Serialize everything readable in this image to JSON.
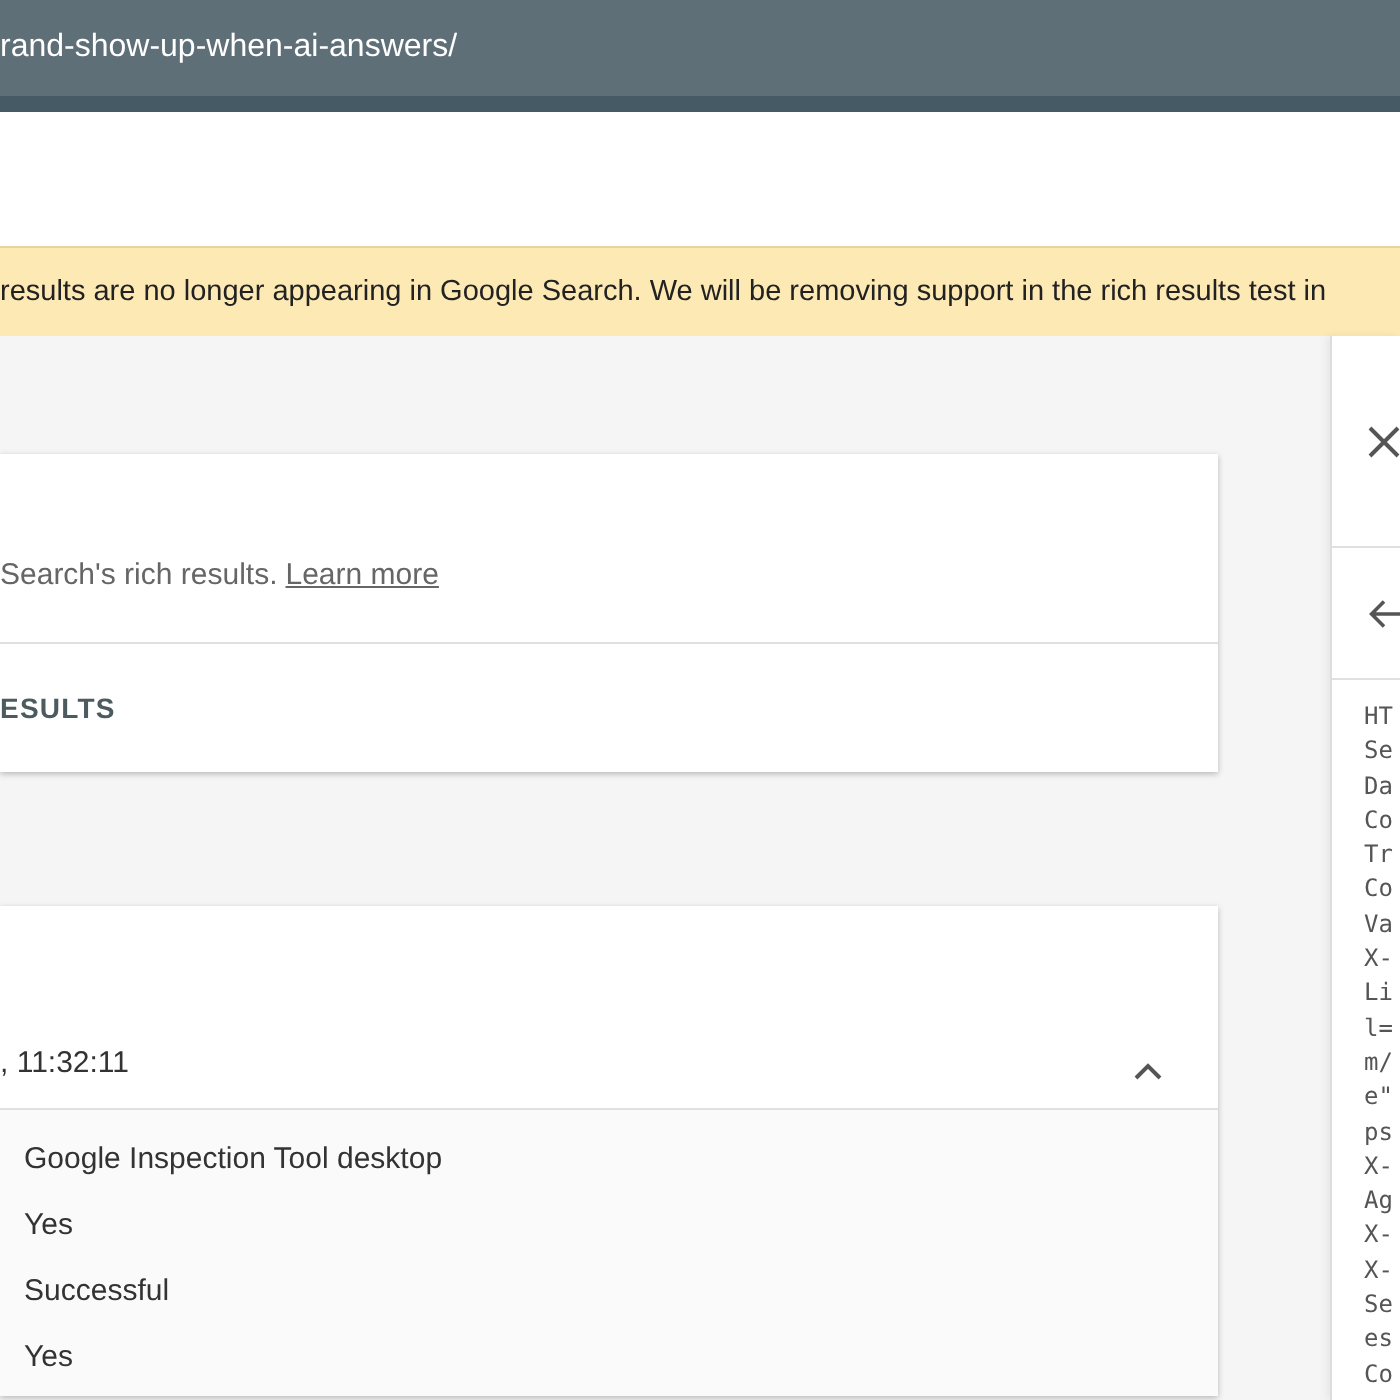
{
  "address_bar": {
    "url": "rand-show-up-when-ai-answers/"
  },
  "banner": {
    "text": "results are no longer appearing in Google Search. We will be removing support in the rich results test in"
  },
  "intro_card": {
    "description": "Search's rich results.",
    "link": "Learn more",
    "action": "ESULTS"
  },
  "inspection_card": {
    "timestamp": ", 11:32:11",
    "expanded": true,
    "details": [
      "Google Inspection Tool desktop",
      "Yes",
      "Successful",
      "Yes"
    ]
  },
  "side_panel": {
    "response_lines": [
      "HT",
      "Se",
      "Da",
      "Co",
      "Tr",
      "Co",
      "Va",
      "X-",
      "Li",
      "l=",
      "m/",
      "e\"",
      "ps",
      "X-",
      "Ag",
      "X-",
      "X-",
      "Se",
      "es",
      "Co"
    ]
  }
}
